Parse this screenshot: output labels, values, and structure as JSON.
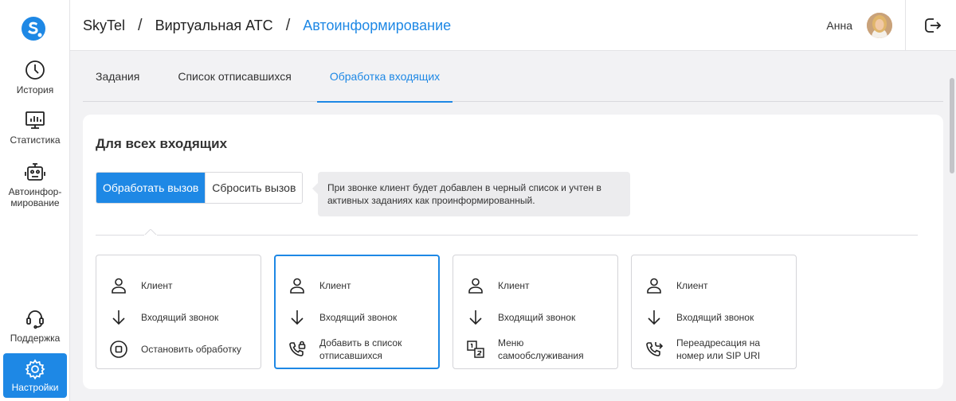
{
  "sidebar": {
    "items": [
      {
        "label": "История",
        "icon": "clock-icon"
      },
      {
        "label": "Статистика",
        "icon": "chart-icon"
      },
      {
        "label": "Автоинфор-мирование",
        "icon": "robot-icon"
      },
      {
        "label": "Поддержка",
        "icon": "headset-icon"
      },
      {
        "label": "Настройки",
        "icon": "gear-icon"
      }
    ]
  },
  "header": {
    "crumbs": [
      "SkyTel",
      "Виртуальная АТС",
      "Автоинформирование"
    ],
    "separator": "/",
    "user_name": "Анна"
  },
  "tabs": [
    "Задания",
    "Список отписавшихся",
    "Обработка входящих"
  ],
  "main": {
    "title": "Для всех входящих",
    "segment": [
      "Обработать вызов",
      "Сбросить вызов"
    ],
    "hint": "При звонке клиент будет добавлен в черный список и учтен в активных заданиях как проинформированный.",
    "flows": [
      {
        "client": "Клиент",
        "incoming": "Входящий звонок",
        "action": "Остановить обработку"
      },
      {
        "client": "Клиент",
        "incoming": "Входящий звонок",
        "action": "Добавить в список отписавшихся"
      },
      {
        "client": "Клиент",
        "incoming": "Входящий звонок",
        "action": "Меню самообслуживания"
      },
      {
        "client": "Клиент",
        "incoming": "Входящий звонок",
        "action": "Переадресация на номер или SIP URI"
      }
    ]
  },
  "colors": {
    "accent": "#1e88e5",
    "background": "#f2f2f4"
  }
}
